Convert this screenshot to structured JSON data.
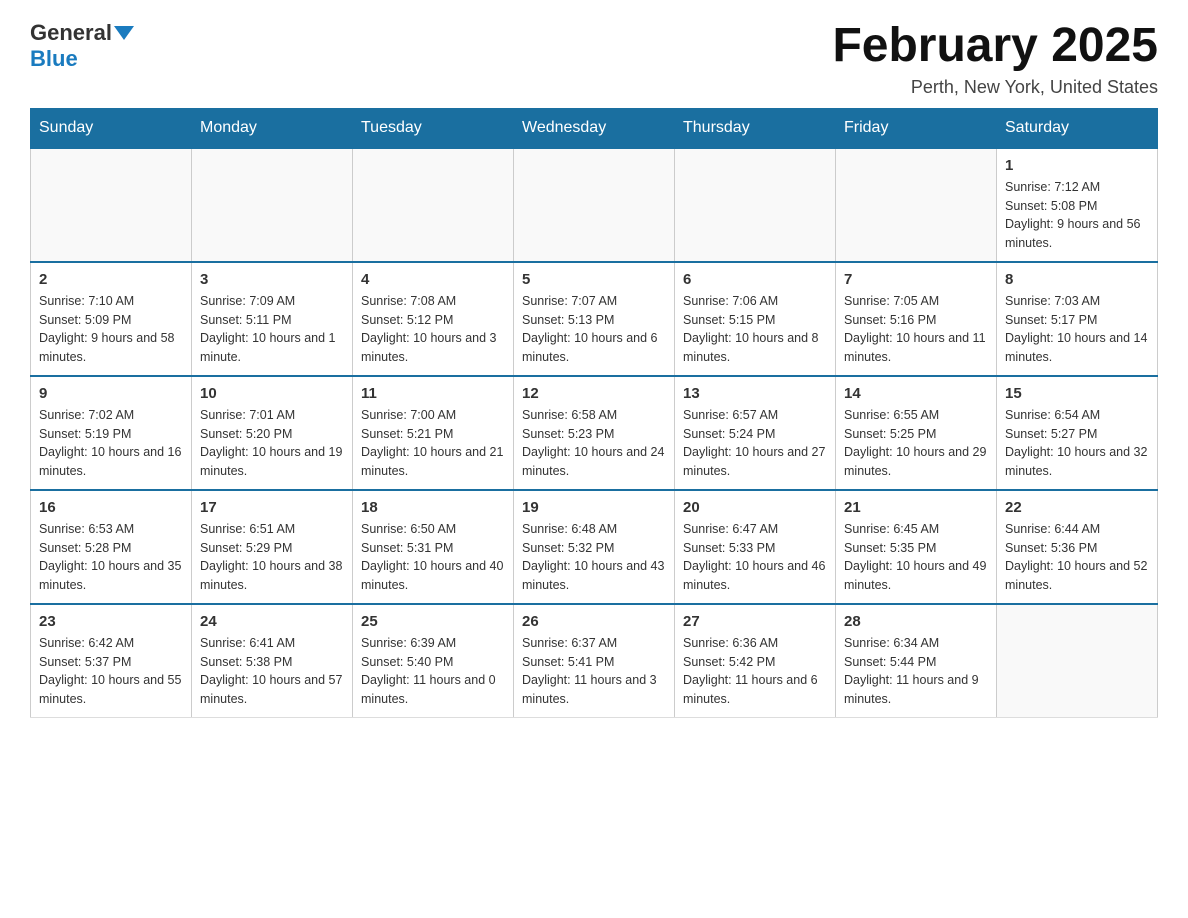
{
  "logo": {
    "general": "General",
    "blue": "Blue"
  },
  "title": "February 2025",
  "location": "Perth, New York, United States",
  "days_of_week": [
    "Sunday",
    "Monday",
    "Tuesday",
    "Wednesday",
    "Thursday",
    "Friday",
    "Saturday"
  ],
  "weeks": [
    [
      {
        "day": "",
        "info": ""
      },
      {
        "day": "",
        "info": ""
      },
      {
        "day": "",
        "info": ""
      },
      {
        "day": "",
        "info": ""
      },
      {
        "day": "",
        "info": ""
      },
      {
        "day": "",
        "info": ""
      },
      {
        "day": "1",
        "info": "Sunrise: 7:12 AM\nSunset: 5:08 PM\nDaylight: 9 hours and 56 minutes."
      }
    ],
    [
      {
        "day": "2",
        "info": "Sunrise: 7:10 AM\nSunset: 5:09 PM\nDaylight: 9 hours and 58 minutes."
      },
      {
        "day": "3",
        "info": "Sunrise: 7:09 AM\nSunset: 5:11 PM\nDaylight: 10 hours and 1 minute."
      },
      {
        "day": "4",
        "info": "Sunrise: 7:08 AM\nSunset: 5:12 PM\nDaylight: 10 hours and 3 minutes."
      },
      {
        "day": "5",
        "info": "Sunrise: 7:07 AM\nSunset: 5:13 PM\nDaylight: 10 hours and 6 minutes."
      },
      {
        "day": "6",
        "info": "Sunrise: 7:06 AM\nSunset: 5:15 PM\nDaylight: 10 hours and 8 minutes."
      },
      {
        "day": "7",
        "info": "Sunrise: 7:05 AM\nSunset: 5:16 PM\nDaylight: 10 hours and 11 minutes."
      },
      {
        "day": "8",
        "info": "Sunrise: 7:03 AM\nSunset: 5:17 PM\nDaylight: 10 hours and 14 minutes."
      }
    ],
    [
      {
        "day": "9",
        "info": "Sunrise: 7:02 AM\nSunset: 5:19 PM\nDaylight: 10 hours and 16 minutes."
      },
      {
        "day": "10",
        "info": "Sunrise: 7:01 AM\nSunset: 5:20 PM\nDaylight: 10 hours and 19 minutes."
      },
      {
        "day": "11",
        "info": "Sunrise: 7:00 AM\nSunset: 5:21 PM\nDaylight: 10 hours and 21 minutes."
      },
      {
        "day": "12",
        "info": "Sunrise: 6:58 AM\nSunset: 5:23 PM\nDaylight: 10 hours and 24 minutes."
      },
      {
        "day": "13",
        "info": "Sunrise: 6:57 AM\nSunset: 5:24 PM\nDaylight: 10 hours and 27 minutes."
      },
      {
        "day": "14",
        "info": "Sunrise: 6:55 AM\nSunset: 5:25 PM\nDaylight: 10 hours and 29 minutes."
      },
      {
        "day": "15",
        "info": "Sunrise: 6:54 AM\nSunset: 5:27 PM\nDaylight: 10 hours and 32 minutes."
      }
    ],
    [
      {
        "day": "16",
        "info": "Sunrise: 6:53 AM\nSunset: 5:28 PM\nDaylight: 10 hours and 35 minutes."
      },
      {
        "day": "17",
        "info": "Sunrise: 6:51 AM\nSunset: 5:29 PM\nDaylight: 10 hours and 38 minutes."
      },
      {
        "day": "18",
        "info": "Sunrise: 6:50 AM\nSunset: 5:31 PM\nDaylight: 10 hours and 40 minutes."
      },
      {
        "day": "19",
        "info": "Sunrise: 6:48 AM\nSunset: 5:32 PM\nDaylight: 10 hours and 43 minutes."
      },
      {
        "day": "20",
        "info": "Sunrise: 6:47 AM\nSunset: 5:33 PM\nDaylight: 10 hours and 46 minutes."
      },
      {
        "day": "21",
        "info": "Sunrise: 6:45 AM\nSunset: 5:35 PM\nDaylight: 10 hours and 49 minutes."
      },
      {
        "day": "22",
        "info": "Sunrise: 6:44 AM\nSunset: 5:36 PM\nDaylight: 10 hours and 52 minutes."
      }
    ],
    [
      {
        "day": "23",
        "info": "Sunrise: 6:42 AM\nSunset: 5:37 PM\nDaylight: 10 hours and 55 minutes."
      },
      {
        "day": "24",
        "info": "Sunrise: 6:41 AM\nSunset: 5:38 PM\nDaylight: 10 hours and 57 minutes."
      },
      {
        "day": "25",
        "info": "Sunrise: 6:39 AM\nSunset: 5:40 PM\nDaylight: 11 hours and 0 minutes."
      },
      {
        "day": "26",
        "info": "Sunrise: 6:37 AM\nSunset: 5:41 PM\nDaylight: 11 hours and 3 minutes."
      },
      {
        "day": "27",
        "info": "Sunrise: 6:36 AM\nSunset: 5:42 PM\nDaylight: 11 hours and 6 minutes."
      },
      {
        "day": "28",
        "info": "Sunrise: 6:34 AM\nSunset: 5:44 PM\nDaylight: 11 hours and 9 minutes."
      },
      {
        "day": "",
        "info": ""
      }
    ]
  ]
}
